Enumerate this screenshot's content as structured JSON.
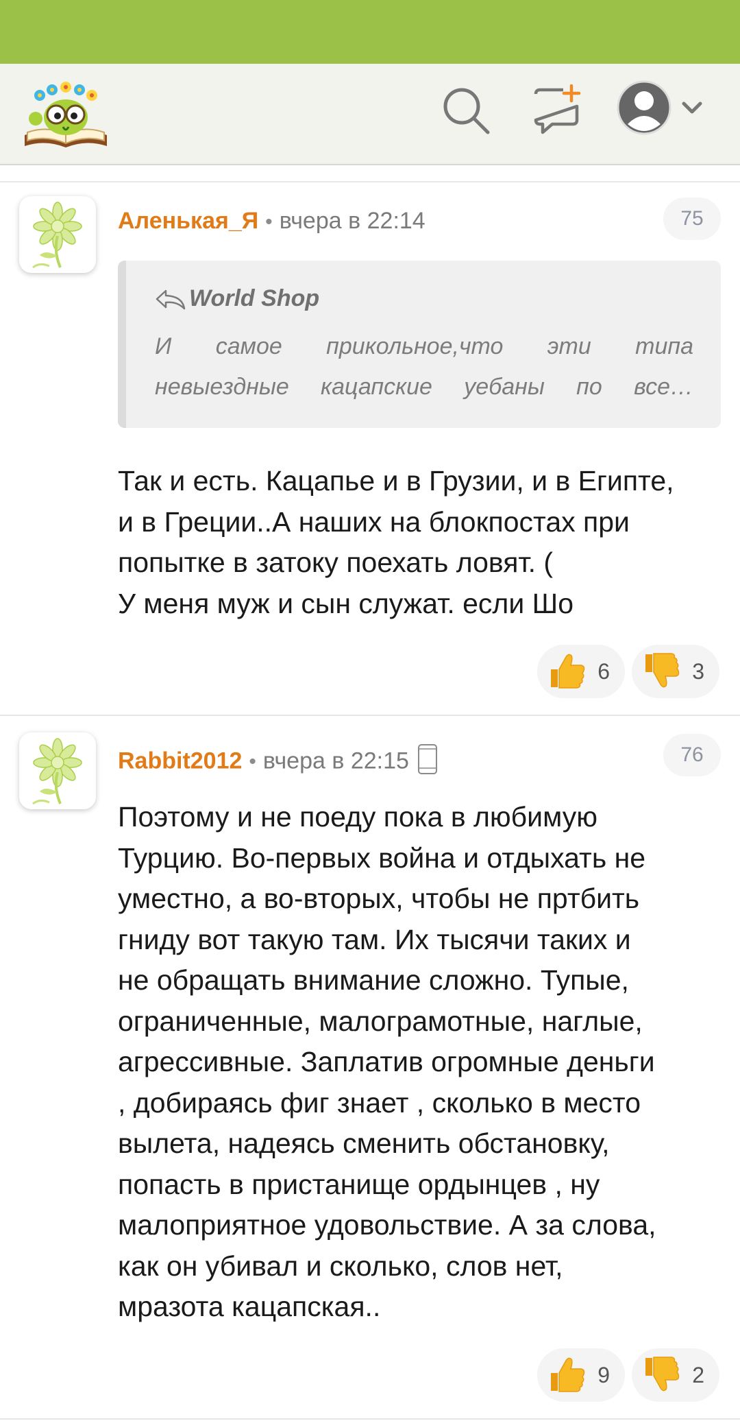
{
  "header": {
    "logo_alt": "logo",
    "icons": [
      "search-icon",
      "new-post-icon",
      "user-avatar-icon",
      "chevron-down-icon"
    ],
    "accent": "#9bc148",
    "new_post_plus_color": "#f08a24"
  },
  "comments": [
    {
      "author": "Аленькая_Я",
      "time": "вчера в 22:14",
      "number": "75",
      "quote": {
        "author": "World Shop",
        "lines": [
          "И самое прикольное,что эти типа",
          "невыездные кацапские уебаны по все…"
        ]
      },
      "body_lines": [
        "Так и есть. Кацапье и в Грузии, и в Египте,",
        "и в Греции..А наших на блокпостах при",
        "попытке в затоку поехать ловят. (",
        "У меня муж и сын служат. если Шо"
      ],
      "likes": "6",
      "dislikes": "3"
    },
    {
      "author": "Rabbit2012",
      "time": "вчера в 22:15",
      "number": "76",
      "body_lines": [
        "Поэтому и не поеду пока в любимую",
        "Турцию. Во-первых война и отдыхать не",
        "уместно, а во-вторых, чтобы не пртбить",
        "гниду вот такую там. Их тысячи таких и",
        "не обращать внимание сложно. Тупые,",
        "ограниченные, малограмотные, наглые,",
        "агрессивные. Заплатив огромные деньги",
        ", добираясь фиг знает , сколько в место",
        "вылета, надеясь сменить обстановку,",
        "попасть в пристанище ордынцев , ну",
        "малоприятное удовольствие. А за слова,",
        "как он убивал и сколько, слов нет,",
        "мразота кацапская.."
      ],
      "likes": "9",
      "dislikes": "2"
    }
  ]
}
